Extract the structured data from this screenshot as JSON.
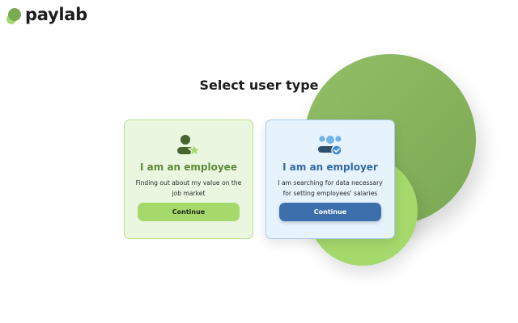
{
  "brand": {
    "name": "paylab"
  },
  "page": {
    "title": "Select user type"
  },
  "cards": [
    {
      "id": "employee",
      "icon": "person-star-icon",
      "title": "I am an employee",
      "description": "Finding out about my value on the job market",
      "button_label": "Continue",
      "accent": "#5d8a3a",
      "button_color": "#a6d96c"
    },
    {
      "id": "employer",
      "icon": "team-check-icon",
      "title": "I am an employer",
      "description": "I am searching for data necessary for setting employees' salaries",
      "button_label": "Continue",
      "accent": "#326aa3",
      "button_color": "#3d6fad"
    }
  ],
  "colors": {
    "brand_green": "#7aaa52",
    "light_green": "#a6d96c",
    "blue": "#3d6fad"
  }
}
